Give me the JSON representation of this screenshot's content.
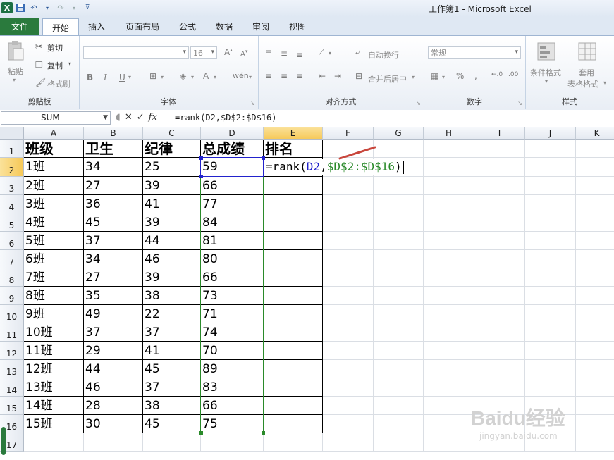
{
  "window": {
    "title": "工作簿1 - Microsoft Excel"
  },
  "qat": {
    "icons": [
      "excel-logo",
      "save-icon",
      "undo-icon",
      "redo-icon",
      "customize-icon"
    ]
  },
  "tabs": [
    "文件",
    "开始",
    "插入",
    "页面布局",
    "公式",
    "数据",
    "审阅",
    "视图"
  ],
  "active_tab": "开始",
  "ribbon": {
    "clipboard": {
      "paste": "粘贴",
      "cut": "剪切",
      "copy": "复制",
      "format_painter": "格式刷",
      "label": "剪贴板"
    },
    "font": {
      "size": "16",
      "bold": "B",
      "italic": "I",
      "underline": "U",
      "label": "字体"
    },
    "alignment": {
      "wrap": "自动换行",
      "merge": "合并后居中",
      "label": "对齐方式"
    },
    "number": {
      "format": "常规",
      "label": "数字"
    },
    "styles": {
      "conditional": "条件格式",
      "table_line1": "套用",
      "table_line2": "表格格式",
      "label": "样式"
    }
  },
  "formula_bar": {
    "name_box": "SUM",
    "formula": "=rank(D2,$D$2:$D$16)"
  },
  "columns": [
    "A",
    "B",
    "C",
    "D",
    "E",
    "F",
    "G",
    "H",
    "I",
    "J",
    "K"
  ],
  "rows": [
    "1",
    "2",
    "3",
    "4",
    "5",
    "6",
    "7",
    "8",
    "9",
    "10",
    "11",
    "12",
    "13",
    "14",
    "15",
    "16",
    "17"
  ],
  "headers": [
    "班级",
    "卫生",
    "纪律",
    "总成绩",
    "排名"
  ],
  "data": [
    [
      "1班",
      "34",
      "25",
      "59"
    ],
    [
      "2班",
      "27",
      "39",
      "66"
    ],
    [
      "3班",
      "36",
      "41",
      "77"
    ],
    [
      "4班",
      "45",
      "39",
      "84"
    ],
    [
      "5班",
      "37",
      "44",
      "81"
    ],
    [
      "6班",
      "34",
      "46",
      "80"
    ],
    [
      "7班",
      "27",
      "39",
      "66"
    ],
    [
      "8班",
      "35",
      "38",
      "73"
    ],
    [
      "9班",
      "49",
      "22",
      "71"
    ],
    [
      "10班",
      "37",
      "37",
      "74"
    ],
    [
      "11班",
      "29",
      "41",
      "70"
    ],
    [
      "12班",
      "44",
      "45",
      "89"
    ],
    [
      "13班",
      "46",
      "37",
      "83"
    ],
    [
      "14班",
      "28",
      "38",
      "66"
    ],
    [
      "15班",
      "30",
      "45",
      "75"
    ]
  ],
  "editing": {
    "prefix": "=rank(",
    "ref1": "D2",
    "comma": ",",
    "ref2": "$D$2:$D$16",
    "suffix": ")"
  },
  "watermark": {
    "brand": "Baidu经验",
    "url": "jingyan.baidu.com"
  },
  "colors": {
    "ref1": "#2222cc",
    "ref2": "#2a8a2a",
    "file_tab": "#2a7a3d",
    "selected_header": "#f6c857",
    "arrow": "#c8463c"
  }
}
